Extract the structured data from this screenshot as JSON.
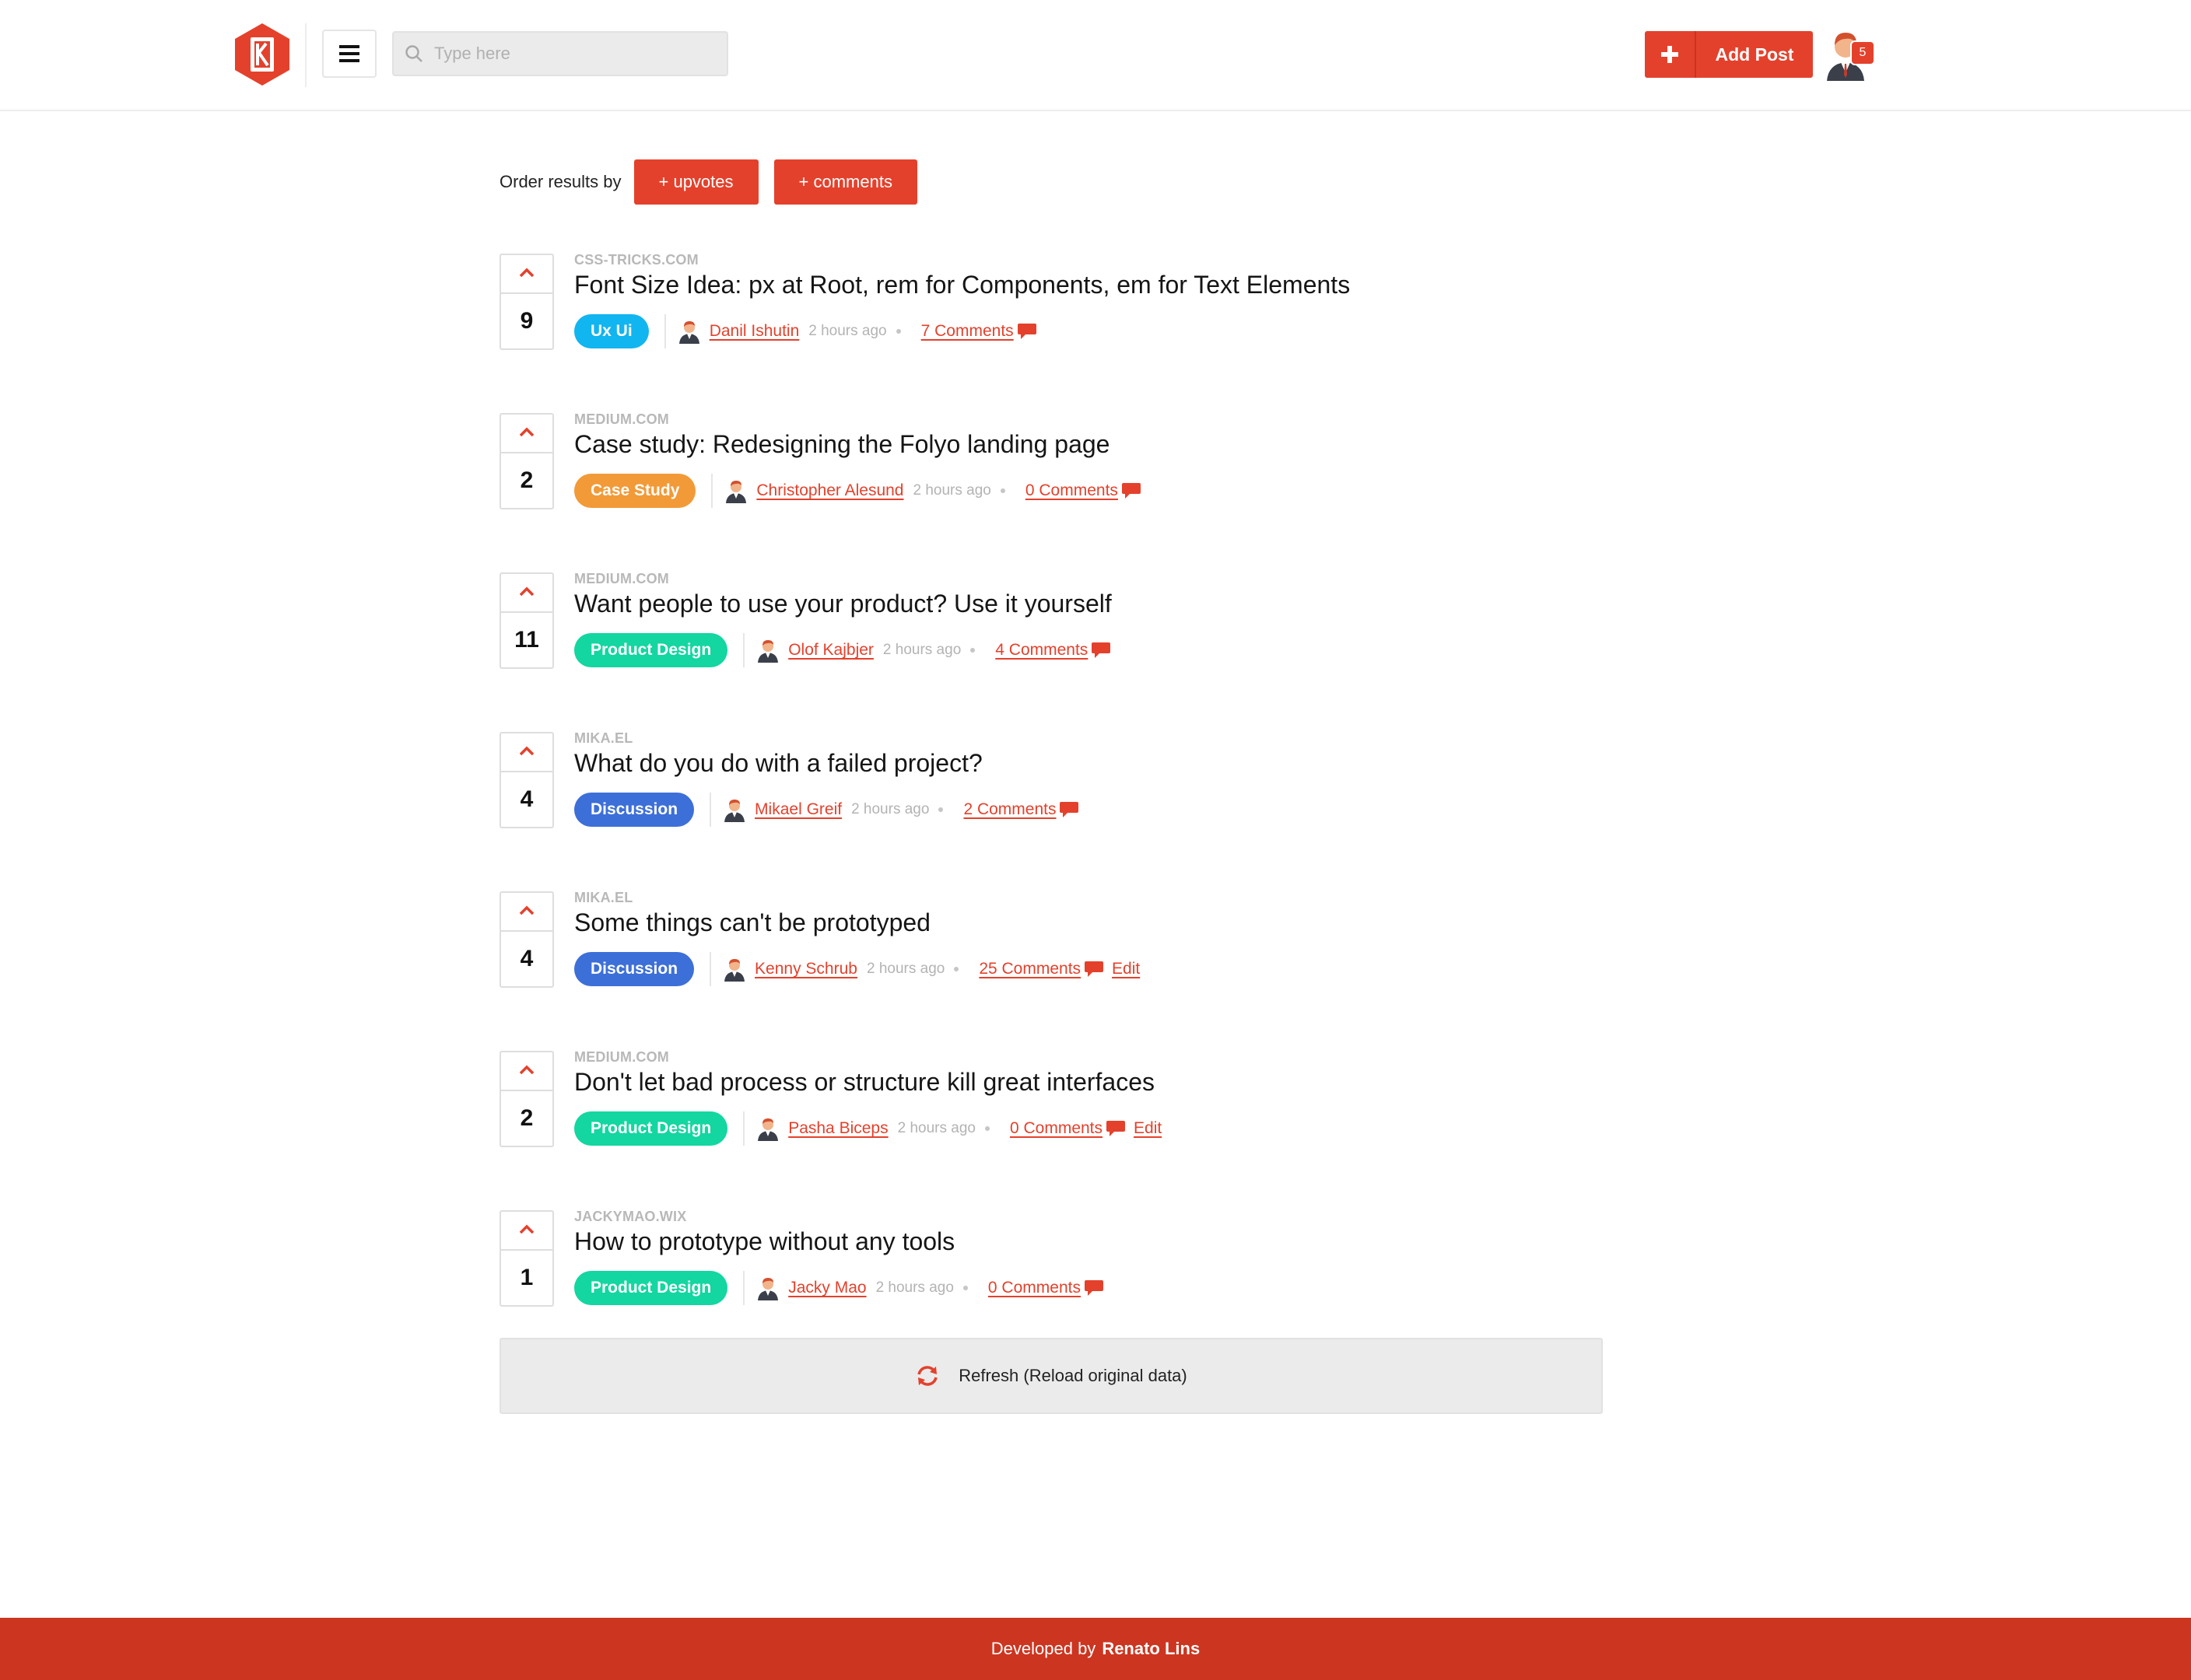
{
  "header": {
    "search_placeholder": "Type here",
    "add_post_label": "Add Post",
    "notification_count": "5"
  },
  "order": {
    "label": "Order results by",
    "upvotes_label": "+ upvotes",
    "comments_label": "+ comments"
  },
  "posts": [
    {
      "votes": "9",
      "source": "CSS-TRICKS.COM",
      "title": "Font Size Idea: px at Root, rem for Components, em for Text Elements",
      "tag": "Ux Ui",
      "tag_color": "#11b5f0",
      "author": "Danil Ishutin",
      "time": "2 hours ago",
      "comments": "7 Comments"
    },
    {
      "votes": "2",
      "source": "MEDIUM.COM",
      "title": "Case study: Redesigning the Folyo landing page",
      "tag": "Case Study",
      "tag_color": "#f29a38",
      "author": "Christopher Alesund",
      "time": "2 hours ago",
      "comments": "0 Comments"
    },
    {
      "votes": "11",
      "source": "MEDIUM.COM",
      "title": "Want people to use your product? Use it yourself",
      "tag": "Product Design",
      "tag_color": "#13d6a0",
      "author": "Olof Kajbjer",
      "time": "2 hours ago",
      "comments": "4 Comments"
    },
    {
      "votes": "4",
      "source": "MIKA.EL",
      "title": "What do you do with a failed project?",
      "tag": "Discussion",
      "tag_color": "#3d6fd8",
      "author": "Mikael Greif",
      "time": "2 hours ago",
      "comments": "2 Comments"
    },
    {
      "votes": "4",
      "source": "MIKA.EL",
      "title": "Some things can't be prototyped",
      "tag": "Discussion",
      "tag_color": "#3d6fd8",
      "author": "Kenny Schrub",
      "time": "2 hours ago",
      "comments": "25 Comments",
      "edit": "Edit"
    },
    {
      "votes": "2",
      "source": "MEDIUM.COM",
      "title": "Don't let bad process or structure kill great interfaces",
      "tag": "Product Design",
      "tag_color": "#13d6a0",
      "author": "Pasha Biceps",
      "time": "2 hours ago",
      "comments": "0 Comments",
      "edit": "Edit"
    },
    {
      "votes": "1",
      "source": "JACKYMAO.WIX",
      "title": "How to prototype without any tools",
      "tag": "Product Design",
      "tag_color": "#13d6a0",
      "author": "Jacky Mao",
      "time": "2 hours ago",
      "comments": "0 Comments"
    }
  ],
  "refresh": {
    "label": "Refresh (Reload original data)"
  },
  "footer": {
    "prefix": "Developed by",
    "author": "Renato Lins"
  },
  "colors": {
    "accent": "#e4412c",
    "footer": "#cc3520"
  },
  "icons": {
    "logo": "hexagon-logo-icon",
    "menu": "hamburger-icon",
    "search": "search-icon",
    "add": "plus-icon",
    "upvote": "chevron-up-icon",
    "author": "user-icon",
    "comment": "speech-bubble-icon",
    "refresh": "refresh-icon"
  }
}
